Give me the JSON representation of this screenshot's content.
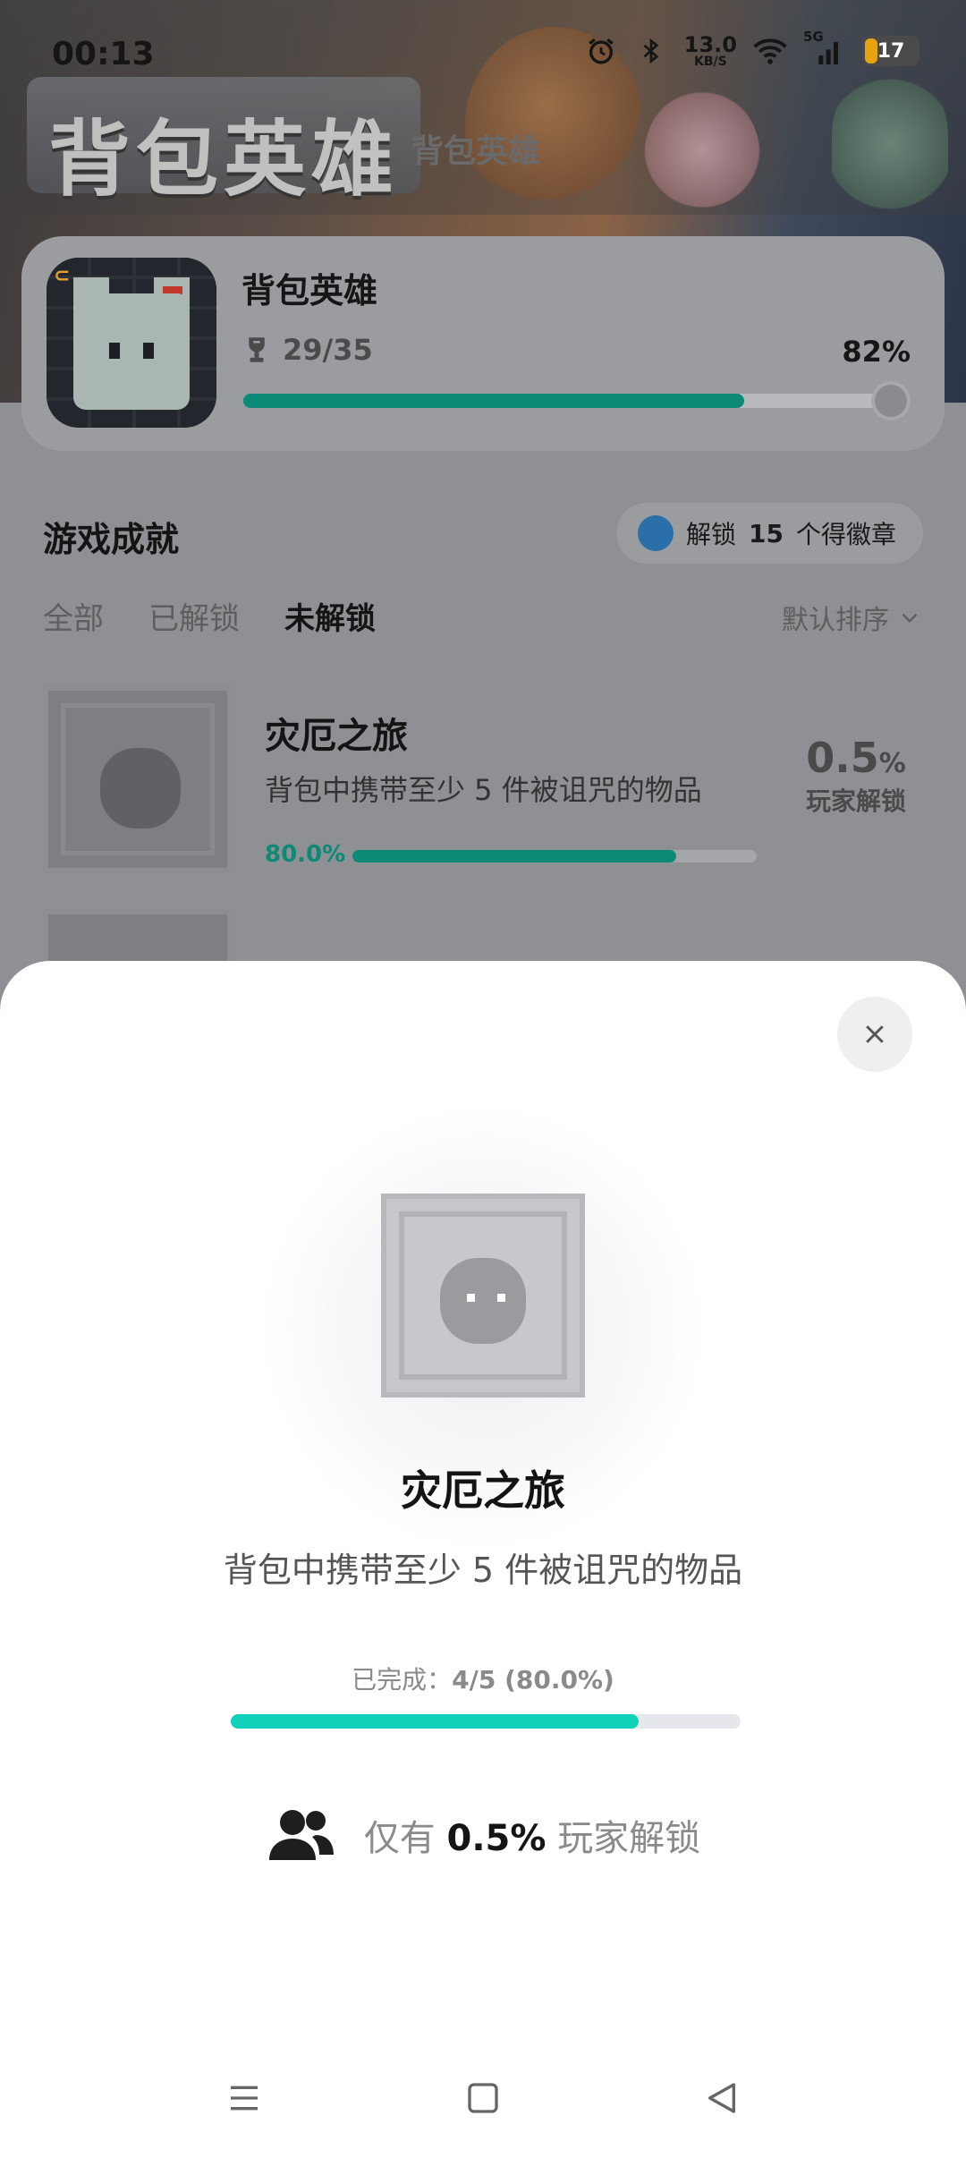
{
  "status_bar": {
    "time": "00:13",
    "net_speed": "13.0",
    "net_unit": "KB/S",
    "network": "5G",
    "battery": "17"
  },
  "hero": {
    "logo_text": "背包英雄",
    "title": "背包英雄"
  },
  "game": {
    "name": "背包英雄",
    "trophies": "29/35",
    "percent": "82%",
    "progress": 0.82
  },
  "achievements": {
    "title": "游戏成就",
    "badge_prefix": "解锁",
    "badge_count": "15",
    "badge_suffix": "个得徽章",
    "tabs": [
      "全部",
      "已解锁",
      "未解锁"
    ],
    "active_tab": "未解锁",
    "sort_label": "默认排序",
    "items": [
      {
        "name": "灾厄之旅",
        "description": "背包中携带至少 5 件被诅咒的物品",
        "progress_label": "80.0%",
        "progress": 0.8,
        "rate_num": "0.5",
        "rate_unit": "%",
        "rate_label": "玩家解锁"
      }
    ]
  },
  "sheet": {
    "title": "灾厄之旅",
    "description": "背包中携带至少 5 件被诅咒的物品",
    "done_prefix": "已完成：",
    "done_value": "4/5 (80.0%)",
    "progress": 0.8,
    "players_prefix": "仅有",
    "players_pct": "0.5%",
    "players_suffix": "玩家解锁"
  },
  "colors": {
    "accent": "#0d8a77",
    "sheet_accent": "#10d1b9"
  }
}
